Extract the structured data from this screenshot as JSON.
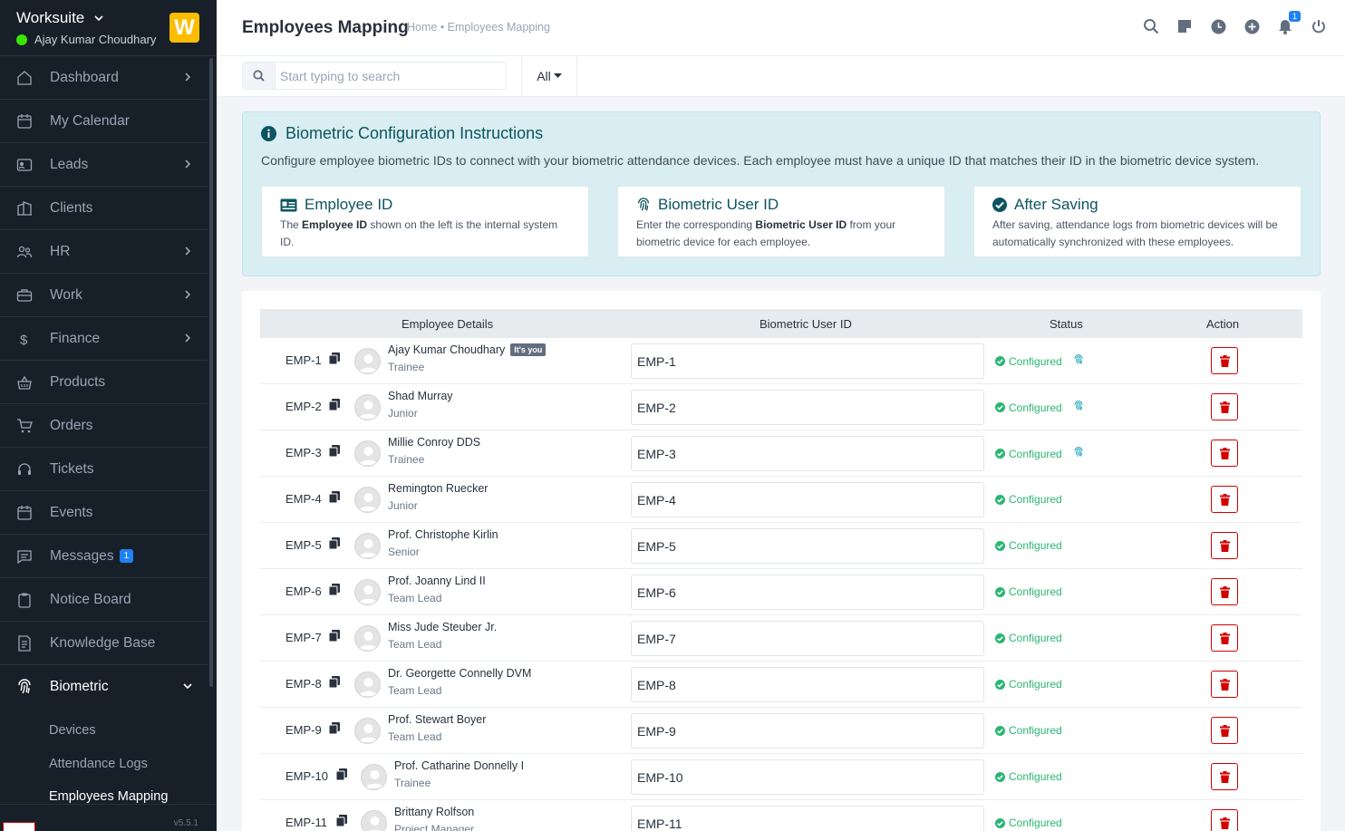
{
  "sidebar": {
    "company": "Worksuite",
    "user": "Ajay Kumar Choudhary",
    "logo_letter": "W",
    "items": [
      {
        "label": "Dashboard",
        "icon": "house-icon",
        "chevron": true
      },
      {
        "label": "My Calendar",
        "icon": "calendar-icon",
        "chevron": false
      },
      {
        "label": "Leads",
        "icon": "id-card-icon",
        "chevron": true
      },
      {
        "label": "Clients",
        "icon": "building-icon",
        "chevron": false
      },
      {
        "label": "HR",
        "icon": "people-icon",
        "chevron": true
      },
      {
        "label": "Work",
        "icon": "briefcase-icon",
        "chevron": true
      },
      {
        "label": "Finance",
        "icon": "dollar-icon",
        "chevron": true
      },
      {
        "label": "Products",
        "icon": "basket-icon",
        "chevron": false
      },
      {
        "label": "Orders",
        "icon": "cart-icon",
        "chevron": false
      },
      {
        "label": "Tickets",
        "icon": "headset-icon",
        "chevron": false
      },
      {
        "label": "Events",
        "icon": "calendar-event-icon",
        "chevron": false
      },
      {
        "label": "Messages",
        "icon": "chat-icon",
        "chevron": false,
        "badge": "1"
      },
      {
        "label": "Notice Board",
        "icon": "clipboard-icon",
        "chevron": false
      },
      {
        "label": "Knowledge Base",
        "icon": "document-icon",
        "chevron": false
      }
    ],
    "active_item": {
      "label": "Biometric",
      "icon": "fingerprint-icon"
    },
    "sub_items": [
      "Devices",
      "Attendance Logs",
      "Employees Mapping"
    ],
    "version": "v5.5.1"
  },
  "header": {
    "title": "Employees Mapping",
    "breadcrumb": "Home • Employees Mapping",
    "notification_count": "1"
  },
  "filter": {
    "search_placeholder": "Start typing to search",
    "all_label": "All"
  },
  "info": {
    "title": "Biometric Configuration Instructions",
    "description": "Configure employee biometric IDs to connect with your biometric attendance devices. Each employee must have a unique ID that matches their ID in the biometric device system.",
    "cards": [
      {
        "title": "Employee ID",
        "pre": "The ",
        "bold": "Employee ID",
        "post": " shown on the left is the internal system ID."
      },
      {
        "title": "Biometric User ID",
        "pre": "Enter the corresponding ",
        "bold": "Biometric User ID",
        "post": " from your biometric device for each employee."
      },
      {
        "title": "After Saving",
        "pre": "After saving, attendance logs from biometric devices will be automatically synchronized with these employees.",
        "bold": "",
        "post": ""
      }
    ]
  },
  "table": {
    "headers": [
      "Employee Details",
      "Biometric User ID",
      "Status",
      "Action"
    ],
    "its_you": "It's you",
    "status_label": "Configured",
    "rows": [
      {
        "emp_id": "EMP-1",
        "name": "Ajay Kumar Choudhary",
        "role": "Trainee",
        "bio_id": "EMP-1",
        "you": true,
        "fingerprint": true
      },
      {
        "emp_id": "EMP-2",
        "name": "Shad Murray",
        "role": "Junior",
        "bio_id": "EMP-2",
        "you": false,
        "fingerprint": true
      },
      {
        "emp_id": "EMP-3",
        "name": "Millie Conroy DDS",
        "role": "Trainee",
        "bio_id": "EMP-3",
        "you": false,
        "fingerprint": true
      },
      {
        "emp_id": "EMP-4",
        "name": "Remington Ruecker",
        "role": "Junior",
        "bio_id": "EMP-4",
        "you": false,
        "fingerprint": false
      },
      {
        "emp_id": "EMP-5",
        "name": "Prof. Christophe Kirlin",
        "role": "Senior",
        "bio_id": "EMP-5",
        "you": false,
        "fingerprint": false
      },
      {
        "emp_id": "EMP-6",
        "name": "Prof. Joanny Lind II",
        "role": "Team Lead",
        "bio_id": "EMP-6",
        "you": false,
        "fingerprint": false
      },
      {
        "emp_id": "EMP-7",
        "name": "Miss Jude Steuber Jr.",
        "role": "Team Lead",
        "bio_id": "EMP-7",
        "you": false,
        "fingerprint": false
      },
      {
        "emp_id": "EMP-8",
        "name": "Dr. Georgette Connelly DVM",
        "role": "Team Lead",
        "bio_id": "EMP-8",
        "you": false,
        "fingerprint": false
      },
      {
        "emp_id": "EMP-9",
        "name": "Prof. Stewart Boyer",
        "role": "Team Lead",
        "bio_id": "EMP-9",
        "you": false,
        "fingerprint": false
      },
      {
        "emp_id": "EMP-10",
        "name": "Prof. Catharine Donnelly I",
        "role": "Trainee",
        "bio_id": "EMP-10",
        "you": false,
        "fingerprint": false
      },
      {
        "emp_id": "EMP-11",
        "name": "Brittany Rolfson",
        "role": "Project Manager",
        "bio_id": "EMP-11",
        "you": false,
        "fingerprint": false
      }
    ]
  },
  "colors": {
    "accent": "#1d82f5",
    "success": "#2bb673",
    "danger": "#d30000",
    "info_bg": "#d9eef2",
    "sidebar_bg": "#171f29"
  }
}
